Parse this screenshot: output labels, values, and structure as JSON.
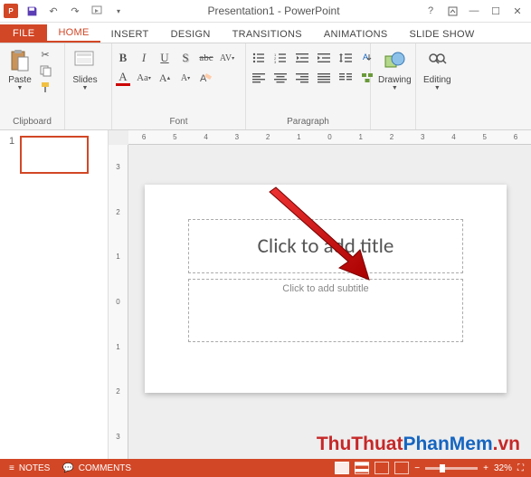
{
  "titlebar": {
    "title": "Presentation1 - PowerPoint",
    "qat": [
      "save-icon",
      "undo-icon",
      "redo-icon",
      "start-icon"
    ]
  },
  "tabs": {
    "file": "FILE",
    "items": [
      "HOME",
      "INSERT",
      "DESIGN",
      "TRANSITIONS",
      "ANIMATIONS",
      "SLIDE SHOW"
    ],
    "active": 0
  },
  "ribbon": {
    "clipboard": {
      "label": "Clipboard",
      "paste": "Paste"
    },
    "slides": {
      "label": "Slides",
      "slides_btn": "Slides"
    },
    "font": {
      "label": "Font"
    },
    "paragraph": {
      "label": "Paragraph"
    },
    "drawing": {
      "label": "Drawing"
    },
    "editing": {
      "label": "Editing"
    }
  },
  "ruler_h": [
    "6",
    "5",
    "4",
    "3",
    "2",
    "1",
    "0",
    "1",
    "2",
    "3",
    "4",
    "5",
    "6"
  ],
  "ruler_v": [
    "3",
    "2",
    "1",
    "0",
    "1",
    "2",
    "3"
  ],
  "slide": {
    "number": "1",
    "title_placeholder": "Click to add title",
    "subtitle_placeholder": "Click to add subtitle"
  },
  "statusbar": {
    "notes": "NOTES",
    "comments": "COMMENTS",
    "zoom": "32%"
  },
  "watermark": {
    "part1": "ThuThuat",
    "part2": "PhanMem",
    "suffix": ".vn"
  }
}
